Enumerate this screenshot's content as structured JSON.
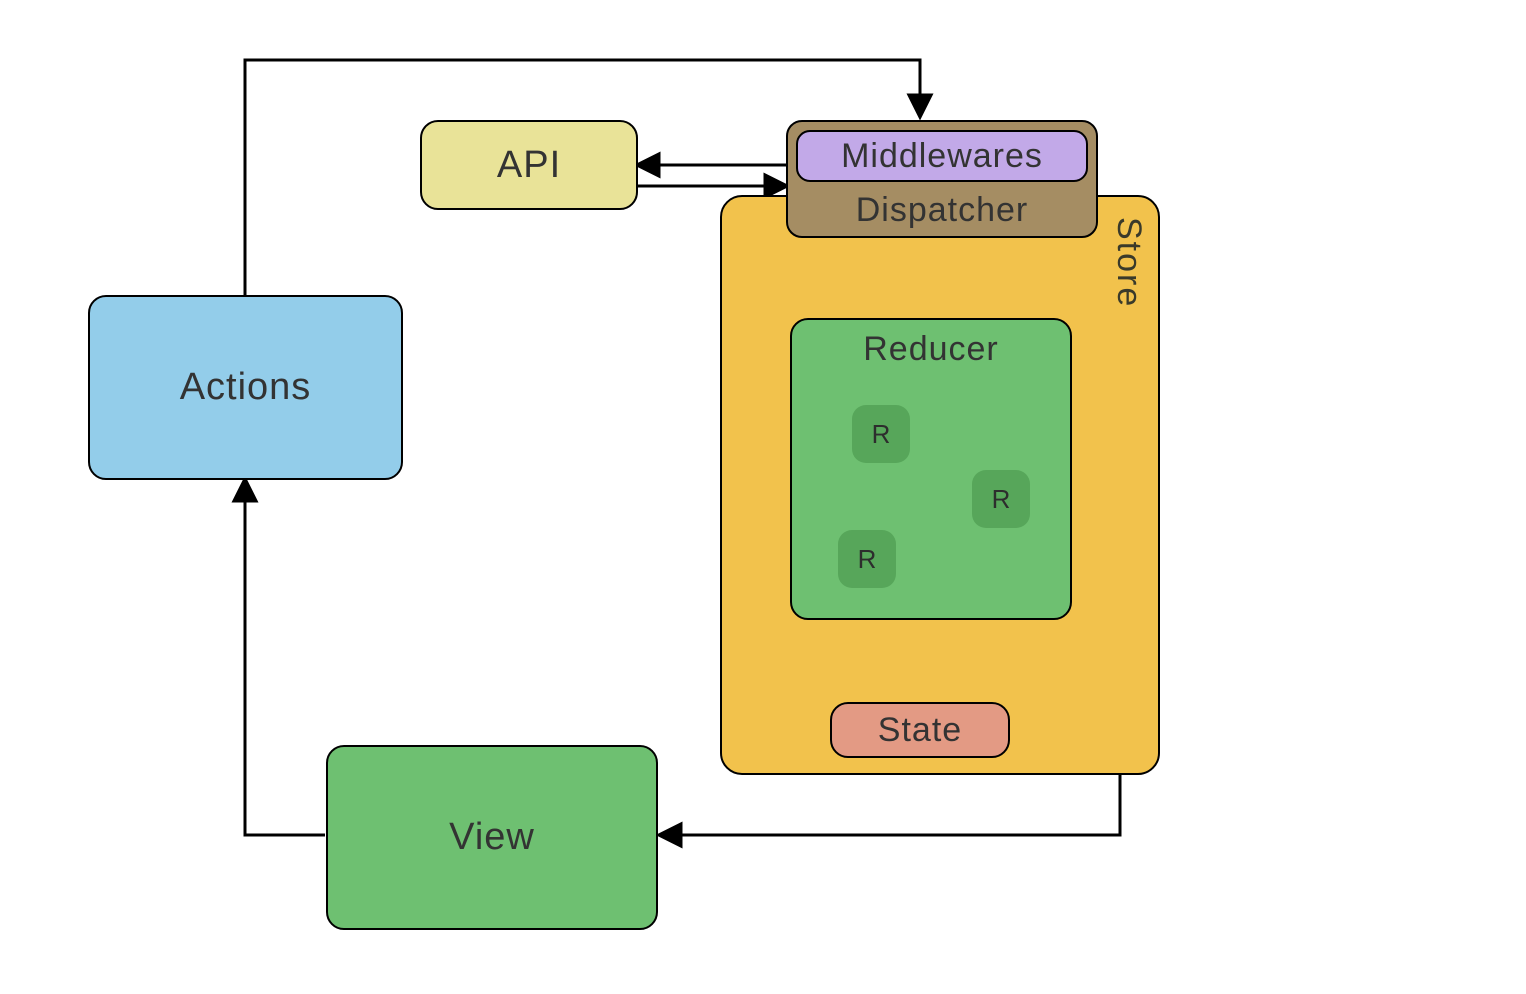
{
  "actions_label": "Actions",
  "api_label": "API",
  "store_label": "Store",
  "dispatcher_label": "Dispatcher",
  "middlewares_label": "Middlewares",
  "reducer_label": "Reducer",
  "reducer_items": {
    "r1": "R",
    "r2": "R",
    "r3": "R"
  },
  "state_label": "State",
  "view_label": "View"
}
